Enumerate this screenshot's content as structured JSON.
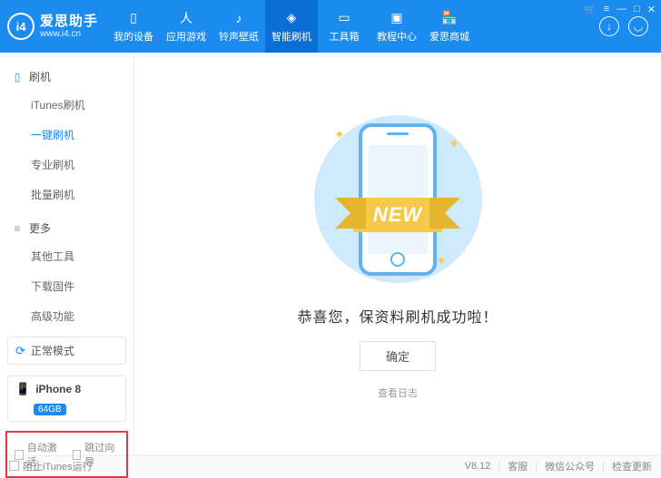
{
  "brand": {
    "logo_text": "i4",
    "name": "爱思助手",
    "url": "www.i4.cn"
  },
  "nav": [
    {
      "icon": "phone-icon",
      "label": "我的设备"
    },
    {
      "icon": "apps-icon",
      "label": "应用游戏"
    },
    {
      "icon": "ringtone-icon",
      "label": "铃声壁纸"
    },
    {
      "icon": "flash-icon",
      "label": "智能刷机",
      "active": true
    },
    {
      "icon": "toolbox-icon",
      "label": "工具箱"
    },
    {
      "icon": "tutorial-icon",
      "label": "教程中心"
    },
    {
      "icon": "shop-icon",
      "label": "爱思商城"
    }
  ],
  "sidebar": {
    "section1": {
      "title": "刷机",
      "items": [
        {
          "label": "iTunes刷机"
        },
        {
          "label": "一键刷机",
          "active": true
        },
        {
          "label": "专业刷机"
        },
        {
          "label": "批量刷机"
        }
      ]
    },
    "section2": {
      "title": "更多",
      "items": [
        {
          "label": "其他工具"
        },
        {
          "label": "下载固件"
        },
        {
          "label": "高级功能"
        }
      ]
    },
    "mode": "正常模式",
    "device": {
      "name": "iPhone 8",
      "storage": "64GB"
    },
    "checks": {
      "auto_activate": "自动激活",
      "skip_guide": "跳过向导"
    }
  },
  "main": {
    "ribbon": "NEW",
    "success": "恭喜您，保资料刷机成功啦！",
    "ok": "确定",
    "view_log": "查看日志"
  },
  "footer": {
    "block_itunes": "阻止iTunes运行",
    "version": "V8.12",
    "support": "客服",
    "wechat": "微信公众号",
    "update": "检查更新"
  }
}
